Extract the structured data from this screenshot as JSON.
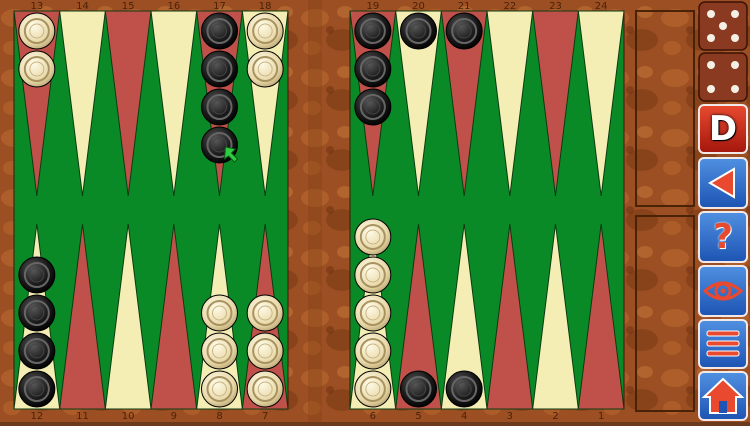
{
  "board": {
    "top_point_numbers": [
      "13",
      "14",
      "15",
      "16",
      "17",
      "18",
      "19",
      "20",
      "21",
      "22",
      "23",
      "24"
    ],
    "bottom_point_numbers": [
      "12",
      "11",
      "10",
      "9",
      "8",
      "7",
      "6",
      "5",
      "4",
      "3",
      "2",
      "1"
    ],
    "checkers": [
      {
        "point": 13,
        "color": "white",
        "count": 2
      },
      {
        "point": 17,
        "color": "black",
        "count": 4
      },
      {
        "point": 18,
        "color": "white",
        "count": 2
      },
      {
        "point": 19,
        "color": "black",
        "count": 3
      },
      {
        "point": 20,
        "color": "black",
        "count": 1
      },
      {
        "point": 21,
        "color": "black",
        "count": 1
      },
      {
        "point": 12,
        "color": "black",
        "count": 4
      },
      {
        "point": 8,
        "color": "white",
        "count": 3
      },
      {
        "point": 7,
        "color": "white",
        "count": 3
      },
      {
        "point": 6,
        "color": "white",
        "count": 5
      },
      {
        "point": 5,
        "color": "black",
        "count": 1
      },
      {
        "point": 4,
        "color": "black",
        "count": 1
      }
    ],
    "move_hint_point": 17
  },
  "dice": [
    5,
    4
  ],
  "controls": {
    "double_label": "D",
    "undo_icon": "left-arrow-icon",
    "hint_label": "?",
    "view_icon": "eye-icon",
    "menu_icon": "hamburger-icon",
    "home_icon": "house-icon"
  },
  "colors": {
    "felt": "#0a8a26",
    "point_light": "#f4eeb4",
    "point_dark": "#c0504a",
    "wood": "#9c4f22",
    "checker_white": "#efe3bc",
    "checker_black": "#1a1a1a",
    "button_blue": "#2c64c8",
    "button_red": "#c42a14"
  }
}
